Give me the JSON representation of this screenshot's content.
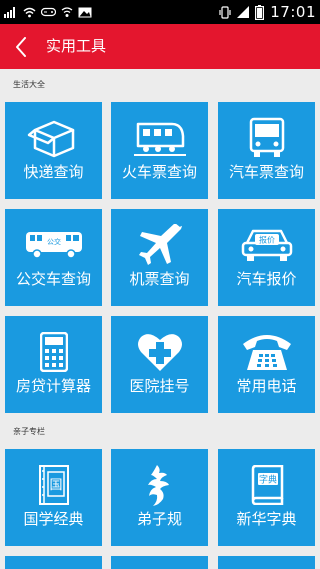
{
  "status_bar": {
    "time": "17:01"
  },
  "app_bar": {
    "title": "实用工具"
  },
  "sections": [
    {
      "title": "生活大全"
    },
    {
      "title": "亲子专栏"
    }
  ],
  "tiles": [
    {
      "label": "快递查询",
      "icon": "package-box-icon"
    },
    {
      "label": "火车票查询",
      "icon": "train-icon"
    },
    {
      "label": "汽车票查询",
      "icon": "coach-bus-icon"
    },
    {
      "label": "公交车查询",
      "icon": "city-bus-icon",
      "badge": "公交"
    },
    {
      "label": "机票查询",
      "icon": "airplane-icon"
    },
    {
      "label": "汽车报价",
      "icon": "car-price-icon",
      "badge": "报价"
    },
    {
      "label": "房贷计算器",
      "icon": "calculator-icon"
    },
    {
      "label": "医院挂号",
      "icon": "hospital-heart-icon"
    },
    {
      "label": "常用电话",
      "icon": "telephone-icon"
    },
    {
      "label": "国学经典",
      "icon": "classics-book-icon",
      "badge": "国"
    },
    {
      "label": "弟子规",
      "icon": "calligraphy-icon"
    },
    {
      "label": "新华字典",
      "icon": "dictionary-icon",
      "badge": "字典"
    }
  ],
  "colors": {
    "app_bar": "#e4162e",
    "tile": "#1a9ae0",
    "background": "#ececec"
  }
}
